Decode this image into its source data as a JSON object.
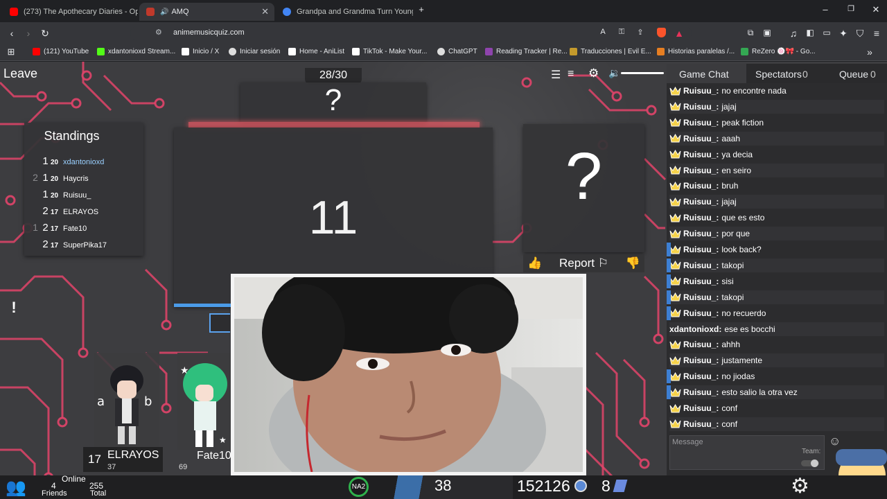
{
  "browser": {
    "tabs": [
      {
        "title": "(273) The Apothecary Diaries - Opening",
        "favicon_color": "#ff0000",
        "active": false
      },
      {
        "title": "AMQ",
        "favicon_color": "#c0392b",
        "active": true
      },
      {
        "title": "Grandpa and Grandma Turn Young A...",
        "favicon_color": "#4285f4",
        "active": false
      }
    ],
    "url": "animemusicquiz.com",
    "bookmarks": [
      {
        "label": "(121) YouTube",
        "color": "#ff0000"
      },
      {
        "label": "xdantonioxd Stream...",
        "color": "#53fc18"
      },
      {
        "label": "Inicio / X",
        "color": "#ffffff"
      },
      {
        "label": "Iniciar sesión",
        "color": "#dddddd"
      },
      {
        "label": "Home - AniList",
        "color": "#ffffff"
      },
      {
        "label": "TikTok - Make Your...",
        "color": "#ffffff"
      },
      {
        "label": "ChatGPT",
        "color": "#dddddd"
      },
      {
        "label": "Reading Tracker | Re...",
        "color": "#8e44ad"
      },
      {
        "label": "Traducciones | Evil E...",
        "color": "#c49a2c"
      },
      {
        "label": "Historias paralelas /...",
        "color": "#e67e22"
      },
      {
        "label": "ReZero 🍥🎀 - Go...",
        "color": "#34a853"
      }
    ]
  },
  "game": {
    "leave_label": "Leave",
    "song_counter": "28/30",
    "question_mark": "?",
    "countdown": "11",
    "progress_fraction": 0.2,
    "anime_placeholder": "?",
    "report_label": "Report",
    "alert_icon": "!",
    "standings": {
      "title": "Standings",
      "rows": [
        {
          "change": "",
          "position": "1",
          "score": "20",
          "name": "xdantonioxd",
          "self": true
        },
        {
          "change": "2",
          "position": "1",
          "score": "20",
          "name": "Haycris",
          "self": false
        },
        {
          "change": "",
          "position": "1",
          "score": "20",
          "name": "Ruisuu_",
          "self": false
        },
        {
          "change": "",
          "position": "2",
          "score": "17",
          "name": "ELRAYOS",
          "self": false
        },
        {
          "change": "1",
          "position": "2",
          "score": "17",
          "name": "Fate10",
          "self": false
        },
        {
          "change": "",
          "position": "2",
          "score": "17",
          "name": "SuperPika17",
          "self": false
        }
      ]
    },
    "players": [
      {
        "score": "17",
        "name": "ELRAYOS",
        "level": "37"
      },
      {
        "score": "",
        "name": "Fate10",
        "level": "69"
      }
    ]
  },
  "chat": {
    "tabs": [
      {
        "label": "Game Chat",
        "count": ""
      },
      {
        "label": "Spectators",
        "count": "0"
      },
      {
        "label": "Queue",
        "count": "0"
      }
    ],
    "messages": [
      {
        "user": "Ruisuu_:",
        "text": "no encontre nada",
        "badge": true,
        "highlight": false
      },
      {
        "user": "Ruisuu_:",
        "text": "jajaj",
        "badge": true,
        "highlight": false
      },
      {
        "user": "Ruisuu_:",
        "text": "peak fiction",
        "badge": true,
        "highlight": false
      },
      {
        "user": "Ruisuu_:",
        "text": "aaah",
        "badge": true,
        "highlight": false
      },
      {
        "user": "Ruisuu_:",
        "text": "ya decia",
        "badge": true,
        "highlight": false
      },
      {
        "user": "Ruisuu_:",
        "text": "en seiro",
        "badge": true,
        "highlight": false
      },
      {
        "user": "Ruisuu_:",
        "text": "bruh",
        "badge": true,
        "highlight": false
      },
      {
        "user": "Ruisuu_:",
        "text": "jajaj",
        "badge": true,
        "highlight": false
      },
      {
        "user": "Ruisuu_:",
        "text": "que es esto",
        "badge": true,
        "highlight": false
      },
      {
        "user": "Ruisuu_:",
        "text": "por que",
        "badge": true,
        "highlight": false
      },
      {
        "user": "Ruisuu_:",
        "text": "look back?",
        "badge": true,
        "highlight": true
      },
      {
        "user": "Ruisuu_:",
        "text": "takopi",
        "badge": true,
        "highlight": true
      },
      {
        "user": "Ruisuu_:",
        "text": "sisi",
        "badge": true,
        "highlight": true
      },
      {
        "user": "Ruisuu_:",
        "text": "takopi",
        "badge": true,
        "highlight": true
      },
      {
        "user": "Ruisuu_:",
        "text": "no recuerdo",
        "badge": true,
        "highlight": true
      },
      {
        "user": "xdantonioxd:",
        "text": "ese es bocchi",
        "badge": false,
        "highlight": false
      },
      {
        "user": "Ruisuu_:",
        "text": "ahhh",
        "badge": true,
        "highlight": false
      },
      {
        "user": "Ruisuu_:",
        "text": "justamente",
        "badge": true,
        "highlight": false
      },
      {
        "user": "Ruisuu_:",
        "text": "no jiodas",
        "badge": true,
        "highlight": true
      },
      {
        "user": "Ruisuu_:",
        "text": "esto salio la otra vez",
        "badge": true,
        "highlight": true
      },
      {
        "user": "Ruisuu_:",
        "text": "conf",
        "badge": true,
        "highlight": false
      },
      {
        "user": "Ruisuu_:",
        "text": "conf",
        "badge": true,
        "highlight": false
      }
    ],
    "message_placeholder": "Message",
    "team_label": "Team:"
  },
  "footer": {
    "online_label": "Online",
    "friends_count": "4",
    "friends_label": "Friends",
    "total_count": "255",
    "total_label": "Total",
    "region": "NA2",
    "level": "38",
    "notes": "152126",
    "tickets": "8"
  },
  "colors": {
    "accent": "#3d7fd3",
    "circuit": "#e2446a",
    "bg": "#3d3d40"
  }
}
